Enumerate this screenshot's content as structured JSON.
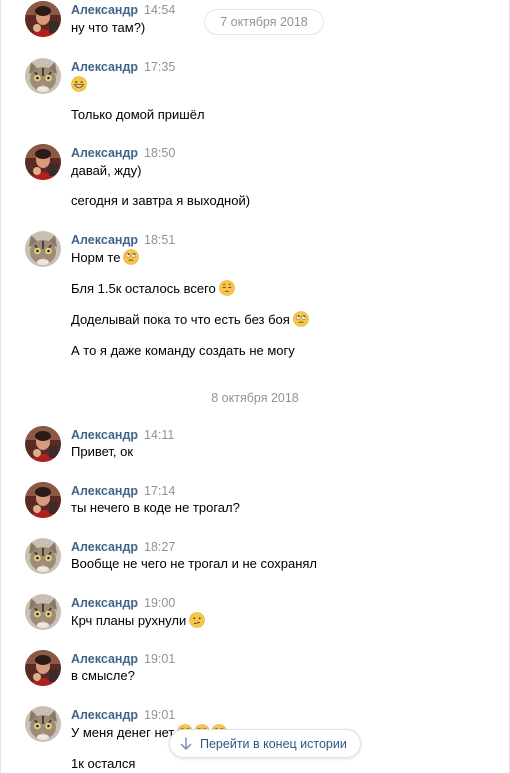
{
  "chat": {
    "floating_date": "7 октября 2018",
    "date_separator": "8 октября 2018",
    "jump_button_label": "Перейти в конец истории",
    "messages": [
      {
        "name": "Александр",
        "time": "14:54",
        "avatar": "person",
        "lines": [
          "ну что там?)"
        ]
      },
      {
        "name": "Александр",
        "time": "17:35",
        "avatar": "cat",
        "lines": [
          "",
          "Только домой пришёл"
        ]
      },
      {
        "name": "Александр",
        "time": "18:50",
        "avatar": "person",
        "lines": [
          "давай, жду)",
          "сегодня и завтра я выходной)"
        ]
      },
      {
        "name": "Александр",
        "time": "18:51",
        "avatar": "cat",
        "lines": [
          "Норм те",
          "Бля 1.5к осталось всего",
          "Доделывай пока то что есть без боя",
          "А то я даже команду создать не могу"
        ]
      },
      {
        "name": "Александр",
        "time": "14:11",
        "avatar": "person",
        "lines": [
          "Привет, ок"
        ]
      },
      {
        "name": "Александр",
        "time": "17:14",
        "avatar": "person",
        "lines": [
          "ты нечего в коде не трогал?"
        ]
      },
      {
        "name": "Александр",
        "time": "18:27",
        "avatar": "cat",
        "lines": [
          "Вообще не чего не трогал и не сохранял"
        ]
      },
      {
        "name": "Александр",
        "time": "19:00",
        "avatar": "cat",
        "lines": [
          "Крч планы рухнули"
        ]
      },
      {
        "name": "Александр",
        "time": "19:01",
        "avatar": "person",
        "lines": [
          "в смысле?"
        ]
      },
      {
        "name": "Александр",
        "time": "19:01",
        "avatar": "cat",
        "lines": [
          "У меня денег нет",
          "1к остался"
        ]
      }
    ]
  },
  "icons": {
    "emoji_grin": "grinning-face-icon",
    "emoji_rolling_eyes": "face-with-rolling-eyes-icon",
    "emoji_pensive": "pensive-face-icon",
    "emoji_confused": "confused-face-icon",
    "jump_arrow": "arrow-down-icon"
  },
  "colors": {
    "name": "#42648b",
    "time": "#939393",
    "link": "#2a5885",
    "emoji": "#f7c64b"
  }
}
